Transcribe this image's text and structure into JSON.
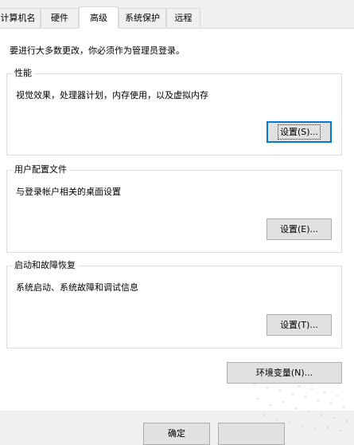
{
  "tabs": [
    "计算机名",
    "硬件",
    "高级",
    "系统保护",
    "远程"
  ],
  "active_tab": "高级",
  "admin_note": "要进行大多数更改，你必须作为管理员登录。",
  "performance": {
    "title": "性能",
    "description": "视觉效果，处理器计划，内存使用，以及虚拟内存",
    "button": "设置(S)..."
  },
  "user_profiles": {
    "title": "用户配置文件",
    "description": "与登录帐户相关的桌面设置",
    "button": "设置(E)..."
  },
  "startup_recovery": {
    "title": "启动和故障恢复",
    "description": "系统启动、系统故障和调试信息",
    "button": "设置(T)..."
  },
  "env_button": "环境变量(N)...",
  "ok_button": "确定"
}
